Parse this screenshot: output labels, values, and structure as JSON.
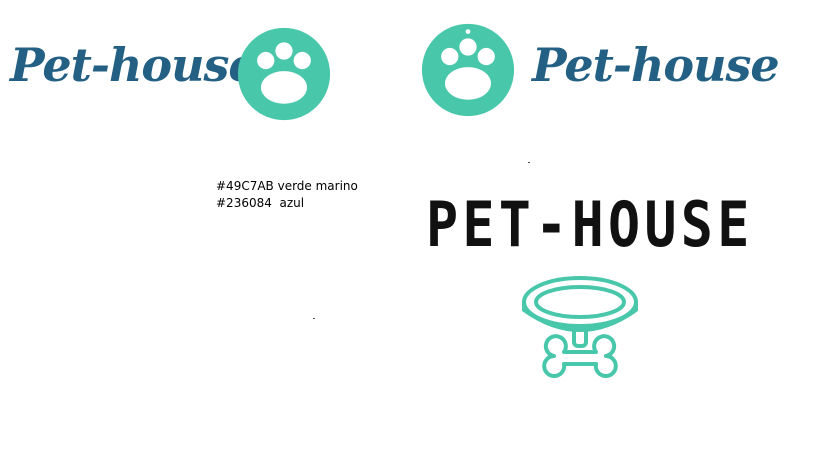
{
  "logos": {
    "logo1": {
      "text": "Pet-house"
    },
    "logo2": {
      "text": "Pet-house"
    },
    "logo3": {
      "text": "PET-HOUSE"
    }
  },
  "palette_notes": {
    "line1": "#49C7AB verde marino",
    "line2": "#236084  azul"
  },
  "colors": {
    "primary_green": "#49C7AB",
    "primary_blue": "#236084",
    "text_black": "#111111"
  },
  "icons": {
    "paw": "paw-icon",
    "collar": "collar-with-bone-tag-icon"
  }
}
